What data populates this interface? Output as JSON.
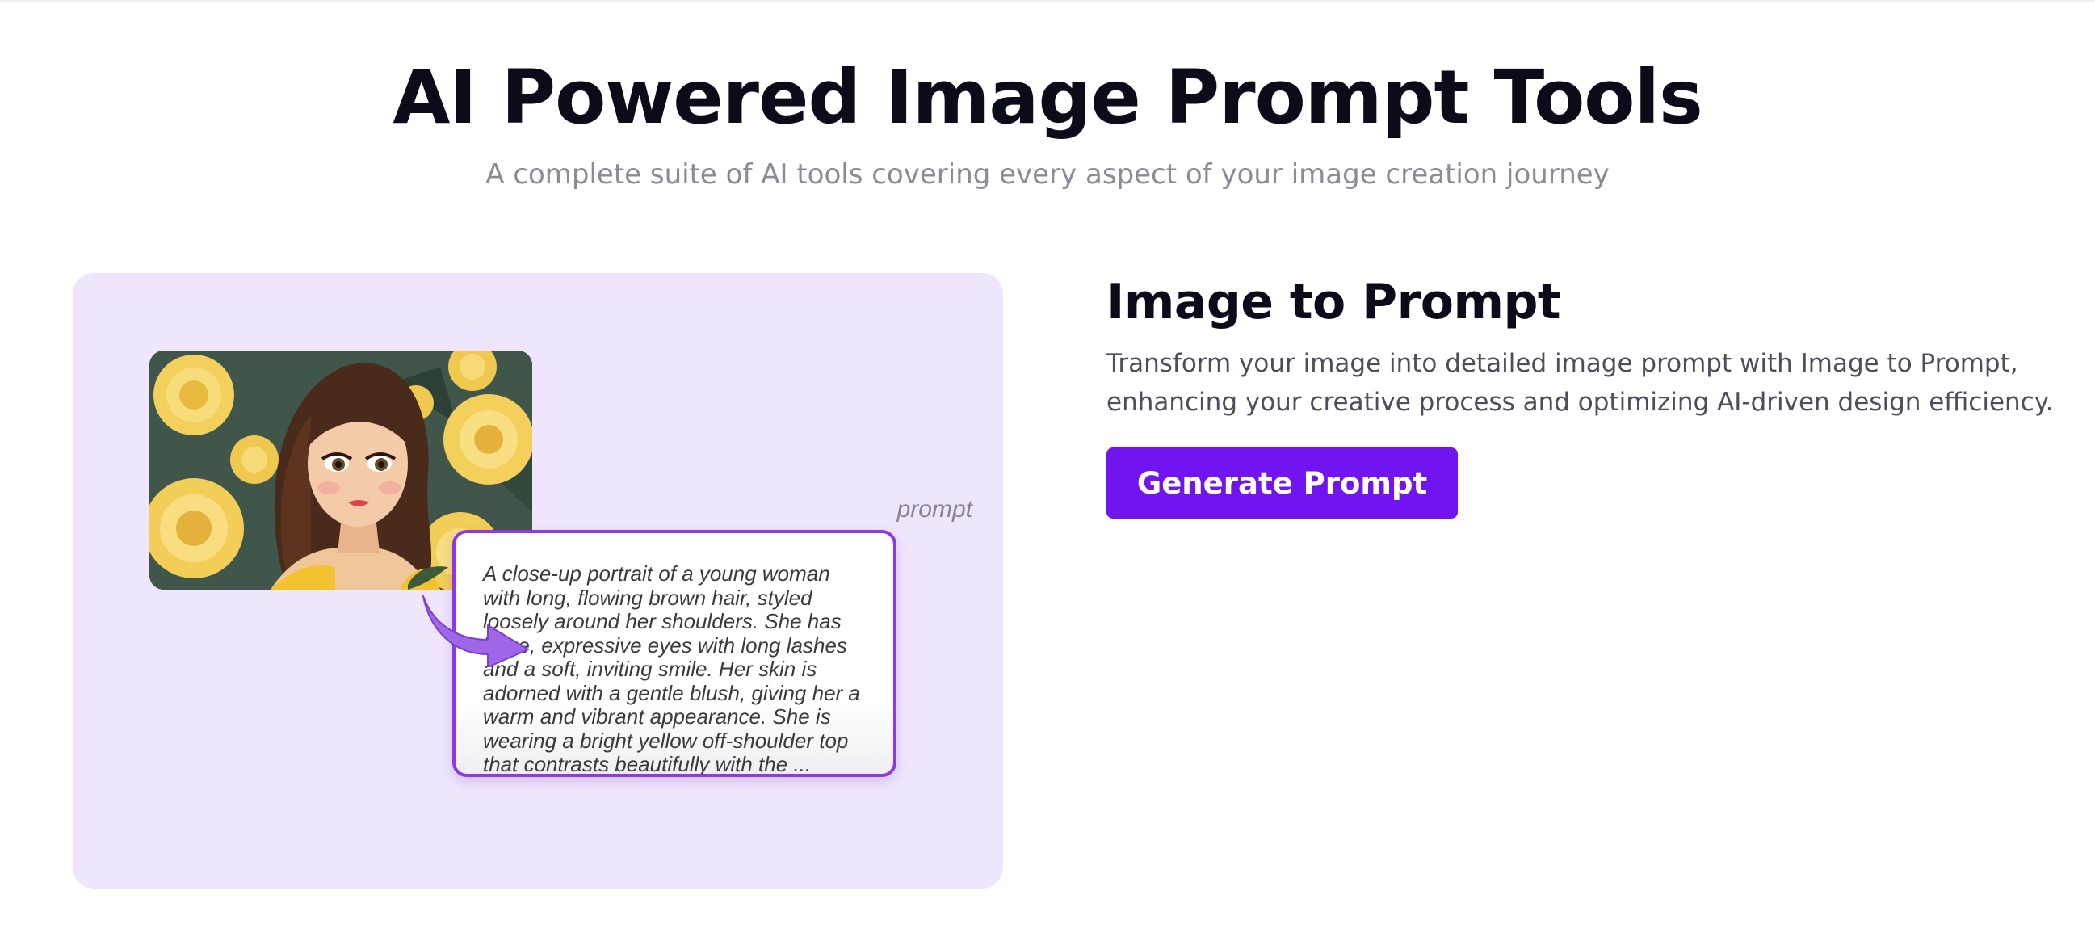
{
  "hero": {
    "title": "AI Powered Image Prompt Tools",
    "subtitle": "A complete suite of AI tools covering every aspect of your image creation journey"
  },
  "illustration": {
    "prompt_label": "prompt",
    "prompt_text": "A close-up portrait of a young woman with long, flowing brown hair, styled loosely around her shoulders. She has large, expressive eyes with long lashes and a soft, inviting smile. Her skin is adorned with a gentle blush, giving her a warm and vibrant appearance. She is wearing a bright yellow off-shoulder top that contrasts beautifully with the ...",
    "arrow_icon": "curved-arrow-icon",
    "image_subject": "portrait-image"
  },
  "feature": {
    "title": "Image to Prompt",
    "description": "Transform your image into detailed image prompt with Image to Prompt, enhancing your creative process and optimizing AI-driven design efficiency.",
    "button_label": "Generate Prompt"
  },
  "colors": {
    "accent": "#7214f0",
    "card_background": "#efe5fd",
    "prompt_border": "#8d39e6",
    "arrow": "#a066ea"
  }
}
